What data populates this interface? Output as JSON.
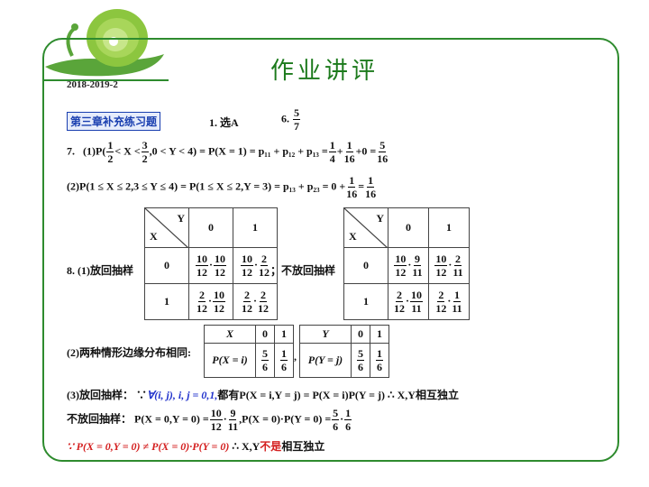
{
  "header": {
    "title": "作业讲评",
    "date": "2018-2019-2"
  },
  "tag": "第三章补充练习题",
  "ans1": "1.  选A",
  "ans6": {
    "label": "6.",
    "num": "5",
    "den": "7"
  },
  "q7": {
    "label": "7.",
    "p1_a": "(1)P(",
    "f1": {
      "num": "1",
      "den": "2"
    },
    "p1_b": "< X <",
    "f2": {
      "num": "3",
      "den": "2"
    },
    "p1_c": ",0 < Y < 4) = P(X = 1) = p₁₁ + p₁₂ + p₁₃ =",
    "f3": {
      "num": "1",
      "den": "4"
    },
    "plus1": "+",
    "f4": {
      "num": "1",
      "den": "16"
    },
    "plus2": "+0 =",
    "f5": {
      "num": "5",
      "den": "16"
    },
    "p2_a": "(2)P(1 ≤ X ≤ 2,3 ≤ Y ≤ 4) = P(1 ≤ X ≤ 2,Y = 3) = p₁₃ + p₂₃ = 0 +",
    "f6": {
      "num": "1",
      "den": "16"
    },
    "p2_eq": "=",
    "f7": {
      "num": "1",
      "den": "16"
    }
  },
  "q8": {
    "label": "8.  (1)放回抽样",
    "mid": "；不放回抽样",
    "corner_y": "Y",
    "corner_x": "X",
    "col0": "0",
    "col1": "1",
    "row0": "0",
    "row1": "1",
    "with": [
      [
        {
          "a": "10",
          "b": "12",
          "c": "10",
          "e": "12"
        },
        {
          "a": "10",
          "b": "12",
          "c": "2",
          "e": "12"
        }
      ],
      [
        {
          "a": "2",
          "b": "12",
          "c": "10",
          "e": "12"
        },
        {
          "a": "2",
          "b": "12",
          "c": "2",
          "e": "12"
        }
      ]
    ],
    "without": [
      [
        {
          "a": "10",
          "b": "12",
          "c": "9",
          "e": "11"
        },
        {
          "a": "10",
          "b": "12",
          "c": "2",
          "e": "11"
        }
      ],
      [
        {
          "a": "2",
          "b": "12",
          "c": "10",
          "e": "11"
        },
        {
          "a": "2",
          "b": "12",
          "c": "1",
          "e": "11"
        }
      ]
    ],
    "dot": "·",
    "p2_label": "(2)两种情形边缘分布相同:",
    "margx": {
      "h": "X",
      "c0": "0",
      "c1": "1",
      "r": "P(X = i)",
      "v0n": "5",
      "v0d": "6",
      "v1n": "1",
      "v1d": "6"
    },
    "comma": ",",
    "margy": {
      "h": "Y",
      "c0": "0",
      "c1": "1",
      "r": "P(Y = j)",
      "v0n": "5",
      "v0d": "6",
      "v1n": "1",
      "v1d": "6"
    },
    "p3_label": "(3)放回抽样：",
    "p3_because": "∵",
    "p3_blue": "∀(i, j), i, j = 0,1,",
    "p3_rest": "都有P(X = i,Y = j) = P(X = i)P(Y = j) ∴ X,Y相互独立",
    "p4_label": "不放回抽样：",
    "p4_a": "P(X = 0,Y = 0) =",
    "g1": {
      "num": "10",
      "den": "12"
    },
    "g2": {
      "num": "9",
      "den": "11"
    },
    "p4_b": ",P(X = 0)·P(Y = 0) =",
    "g3": {
      "num": "5",
      "den": "6"
    },
    "g4": {
      "num": "1",
      "den": "6"
    },
    "p5_red": "∵ P(X = 0,Y = 0) ≠ P(X = 0)·P(Y = 0)",
    "p5_mid": "∴ X,Y",
    "p5_red2": "不是",
    "p5_end": "相互独立"
  },
  "colors": {
    "green": "#2e8b2e",
    "blue": "#2233cc",
    "red": "#d42020"
  }
}
